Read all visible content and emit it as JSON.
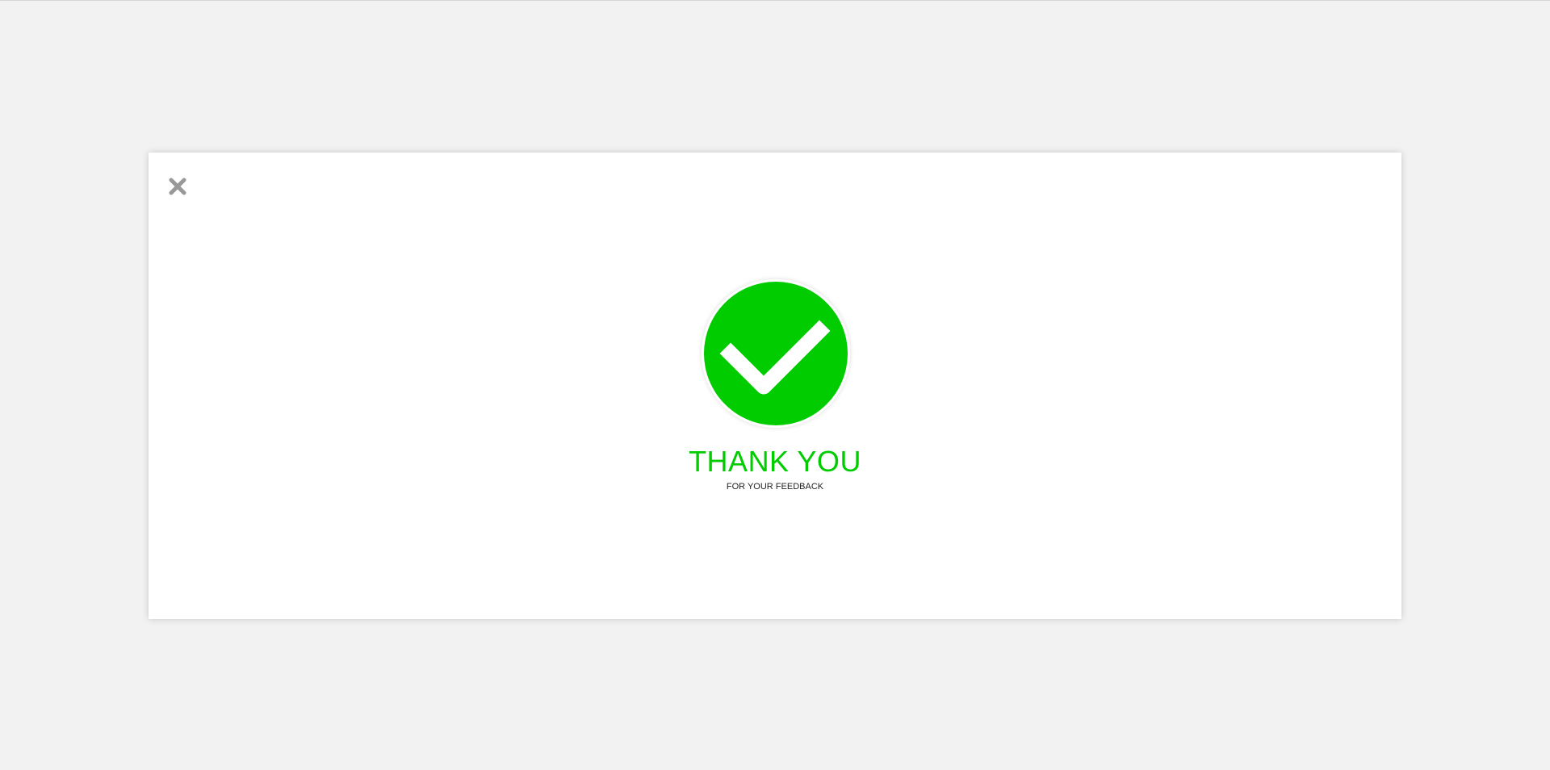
{
  "modal": {
    "close_icon": "close-icon",
    "status_icon": "checkmark-circle-icon",
    "title": "THANK YOU",
    "subtitle": "FOR YOUR FEEDBACK"
  },
  "colors": {
    "background": "#f2f2f2",
    "modal": "#ffffff",
    "accent_green": "#00cc00",
    "close_icon": "#999999",
    "subtitle_text": "#222222"
  }
}
